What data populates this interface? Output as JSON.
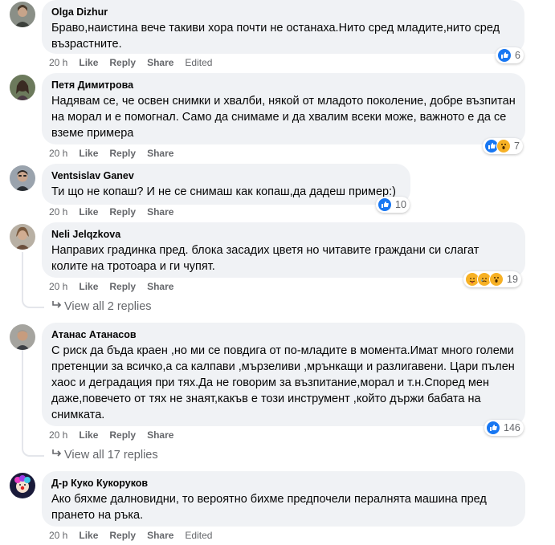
{
  "comments": [
    {
      "author": "Olga Dizhur",
      "text": "Браво,наистина вече такиви хора почти не останаха.Нито сред младите,нито сред възрастните.",
      "time": "20 h",
      "like": "Like",
      "reply": "Reply",
      "share": "Share",
      "edited": "Edited",
      "reactions": [
        "like-icon"
      ],
      "reaction_count": "6"
    },
    {
      "author": "Петя Димитрова",
      "text": "Надявам се, че освен снимки и хвалби, някой от младото поколение, добре възпитан на морал и е помогнал. Само да снимаме и да хвалим всеки може, важното е да се вземе примера",
      "time": "20 h",
      "like": "Like",
      "reply": "Reply",
      "share": "Share",
      "reactions": [
        "like-icon",
        "wow-icon"
      ],
      "reaction_count": "7"
    },
    {
      "author": "Ventsislav Ganev",
      "text": "Ти що не копаш? И не се снимаш как копаш,да дадеш пример:)",
      "time": "20 h",
      "like": "Like",
      "reply": "Reply",
      "share": "Share",
      "reactions": [
        "like-icon"
      ],
      "reaction_count": "10"
    },
    {
      "author": "Neli Jelqzkova",
      "text": "Направих градинка пред. блока засадих цветя но читавите граждани си слагат колите на тротоара и ги чупят.",
      "time": "20 h",
      "like": "Like",
      "reply": "Reply",
      "share": "Share",
      "reactions": [
        "care-icon",
        "sad-icon",
        "wow-icon"
      ],
      "reaction_count": "19",
      "view_replies": "View all 2 replies"
    },
    {
      "author": "Атанас Атанасов",
      "text": "С риск да бъда краен ,но ми се повдига от по-младите в момента.Имат много големи претенции за всичко,а са калпави ,мързеливи ,мрънкащи и разлигавени. Цари пълен хаос и деградация при тях.Да не говорим за възпитание,морал и т.н.Според мен даже,повечето от тях не знаят,какъв е този инструмент ,който държи бабата на снимката.",
      "time": "20 h",
      "like": "Like",
      "reply": "Reply",
      "share": "Share",
      "reactions": [
        "like-icon"
      ],
      "reaction_count": "146",
      "view_replies": "View all 17 replies"
    },
    {
      "author": "Д-р Куко Кукоруков",
      "text": "Ако бяхме далновидни, то вероятно бихме предпочели пералнята машина пред прането на ръка.",
      "time": "20 h",
      "like": "Like",
      "reply": "Reply",
      "share": "Share",
      "edited": "Edited"
    }
  ],
  "colors": {
    "bubble": "#f0f2f5",
    "meta": "#65676b",
    "like_blue": "#1877f2",
    "emoji_yellow": "#f7b125"
  }
}
